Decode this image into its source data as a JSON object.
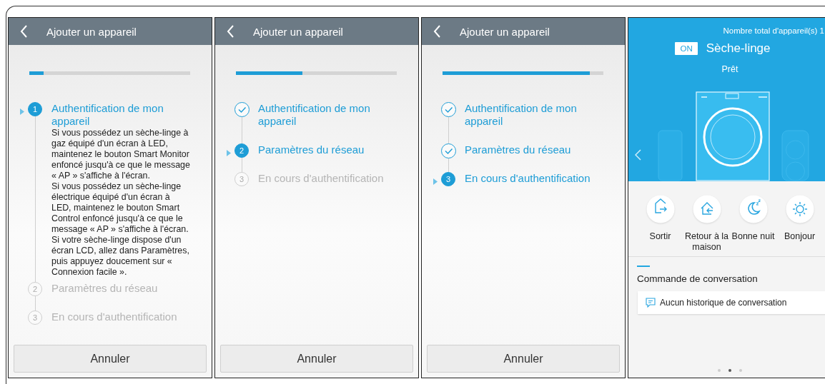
{
  "screens": [
    {
      "kind": "setup",
      "title": "Ajouter un appareil",
      "progress": {
        "level": 0.09
      },
      "steps": [
        {
          "done": false,
          "current": true,
          "number": "1",
          "label": "Authentification de mon appareil",
          "description": [
            "Si vous possédez un sèche-linge à gaz équipé d'un écran à LED, maintenez le bouton Smart Monitor enfoncé jusqu'à ce que le message « AP » s'affiche à l'écran.",
            "Si vous possédez un sèche-linge électrique équipé d'un écran à LED, maintenez le bouton Smart Control enfoncé jusqu'à ce que le message « AP » s'affiche à l'écran.",
            "Si votre sèche-linge dispose d'un écran LCD, allez dans Paramètres, puis appuyez doucement sur « Connexion facile »."
          ]
        },
        {
          "done": false,
          "current": false,
          "number": "2",
          "label": "Paramètres du réseau"
        },
        {
          "done": false,
          "current": false,
          "number": "3",
          "label": "En cours d'authentification"
        }
      ],
      "cancel": "Annuler"
    },
    {
      "kind": "setup",
      "title": "Ajouter un appareil",
      "progress": {
        "level": 0.415
      },
      "steps": [
        {
          "done": true,
          "current": false,
          "label": "Authentification de mon appareil"
        },
        {
          "done": false,
          "current": true,
          "number": "2",
          "label": "Paramètres du réseau"
        },
        {
          "done": false,
          "current": false,
          "number": "3",
          "label": "En cours d'authentification"
        }
      ],
      "cancel": "Annuler"
    },
    {
      "kind": "setup",
      "title": "Ajouter un appareil",
      "progress": {
        "level": 0.915
      },
      "steps": [
        {
          "done": true,
          "current": false,
          "label": "Authentification de mon appareil"
        },
        {
          "done": true,
          "current": false,
          "label": "Paramètres du réseau"
        },
        {
          "done": false,
          "current": true,
          "number": "3",
          "label": "En cours d'authentification"
        }
      ],
      "cancel": "Annuler"
    },
    {
      "kind": "dashboard",
      "device_count": "Nombre total d'appareil(s) 1",
      "power_badge": "ON",
      "device_name": "Sèche-linge",
      "status": "Prêt",
      "modes": [
        {
          "kind": "leave",
          "label": "Sortir"
        },
        {
          "kind": "home",
          "label": "Retour à la maison"
        },
        {
          "kind": "night",
          "label": "Bonne nuit"
        },
        {
          "kind": "morning",
          "label": "Bonjour"
        }
      ],
      "section_title": "Commande de conversation",
      "empty_message": "Aucun historique de conversation",
      "page_dots": [
        {
          "selected": false
        },
        {
          "selected": true
        },
        {
          "selected": false
        }
      ]
    }
  ]
}
